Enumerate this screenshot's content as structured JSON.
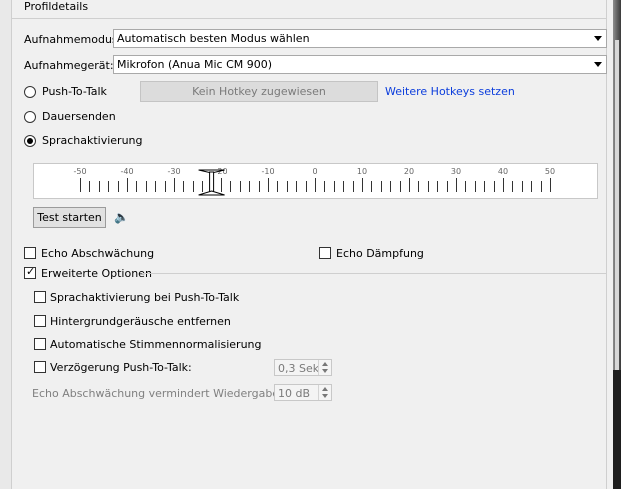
{
  "group": {
    "title": "Profildetails"
  },
  "recording": {
    "mode_label": "Aufnahmemodus:",
    "mode_value": "Automatisch besten Modus wählen",
    "device_label": "Aufnahmegerät:",
    "device_value": "Mikrofon (Anua Mic CM 900)"
  },
  "transmit": {
    "push_to_talk": "Push-To-Talk",
    "hotkey_button": "Kein Hotkey zugewiesen",
    "more_hotkeys": "Weitere Hotkeys setzen",
    "continuous": "Dauersenden",
    "voice_activation": "Sprachaktivierung",
    "selected": "voice_activation"
  },
  "meter": {
    "labels": [
      "-50",
      "-40",
      "-30",
      "-20",
      "-10",
      "0",
      "10",
      "20",
      "30",
      "40",
      "50"
    ],
    "threshold": -22
  },
  "test_button": "Test starten",
  "echo": {
    "reduction": "Echo Abschwächung",
    "damping": "Echo Dämpfung"
  },
  "advanced": {
    "title": "Erweiterte Optionen",
    "checked": true,
    "options": [
      "Sprachaktivierung bei Push-To-Talk",
      "Hintergrundgeräusche entfernen",
      "Automatische Stimmennormalisierung",
      "Verzögerung Push-To-Talk:"
    ],
    "delay_value": "0,3 Sek",
    "attenuation_label": "Echo Abschwächung vermindert Wiedergabe um:",
    "attenuation_value": "10 dB"
  }
}
